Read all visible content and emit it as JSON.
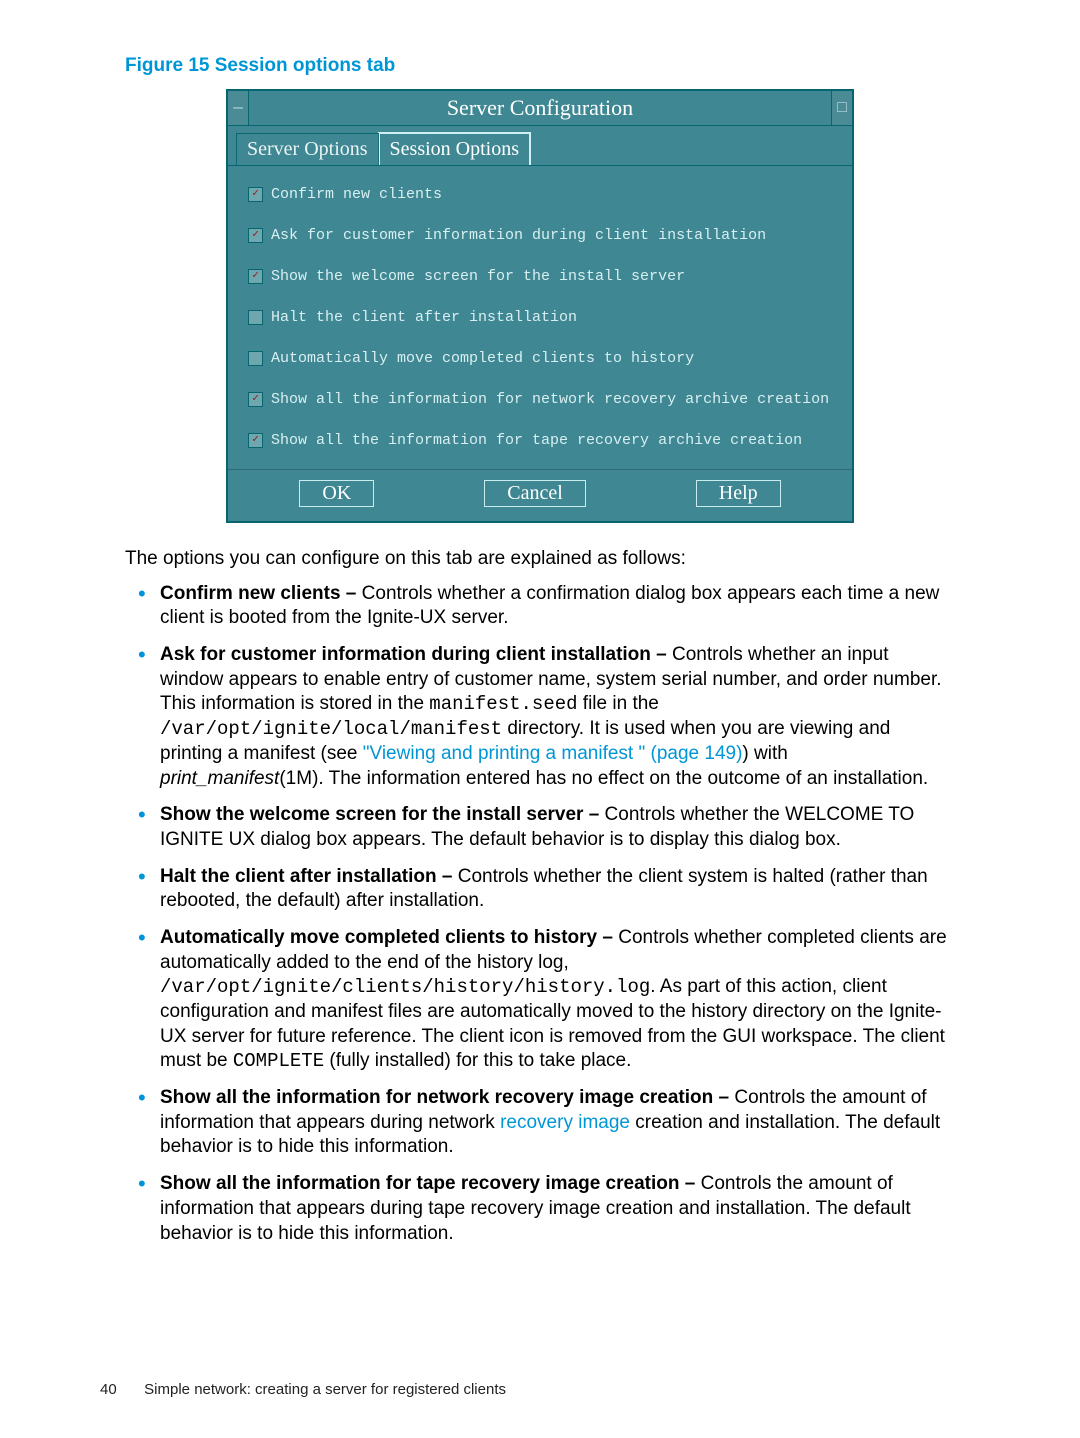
{
  "figure_caption": "Figure 15 Session options tab",
  "dialog": {
    "title": "Server Configuration",
    "sys_menu_glyph": "—",
    "max_glyph": "□",
    "tabs": {
      "server_options": "Server Options",
      "session_options": "Session Options"
    },
    "options": [
      {
        "label": "Confirm new clients",
        "checked": true
      },
      {
        "label": "Ask for customer information during client installation",
        "checked": true
      },
      {
        "label": "Show the welcome screen for the install server",
        "checked": true
      },
      {
        "label": "Halt the client after installation",
        "checked": false
      },
      {
        "label": "Automatically move completed clients to history",
        "checked": false
      },
      {
        "label": "Show all the information for network recovery archive creation",
        "checked": true
      },
      {
        "label": "Show all the information for tape recovery archive creation",
        "checked": true
      }
    ],
    "buttons": {
      "ok": "OK",
      "cancel": "Cancel",
      "help": "Help"
    }
  },
  "intro": "The options you can configure on this tab are explained as follows:",
  "items": {
    "confirm": {
      "title": "Confirm new clients –",
      "rest": " Controls whether a confirmation dialog box appears each time a new client is booted from the Ignite-UX server."
    },
    "ask": {
      "title": "Ask for customer information during client installation –",
      "p1": " Controls whether an input window appears to enable entry of customer name, system serial number, and order number. This information is stored in the ",
      "m1": "manifest.seed",
      "p2": " file in the ",
      "m2": "/var/opt/ignite/local/manifest",
      "p3": " directory. It is used when you are viewing and printing a manifest (see ",
      "link": "\"Viewing and printing a manifest \" (page 149)",
      "p4": ") with ",
      "it": "print_manifest",
      "p5": "(1M). The information entered has no effect on the outcome of an installation."
    },
    "welcome": {
      "title": "Show the welcome screen for the install server –",
      "rest": " Controls whether the WELCOME TO IGNITE UX dialog box appears. The default behavior is to display this dialog box."
    },
    "halt": {
      "title": "Halt the client after installation –",
      "rest": " Controls whether the client system is halted (rather than rebooted, the default) after installation."
    },
    "auto": {
      "title": "Automatically move completed clients to history –",
      "p1": " Controls whether completed clients are automatically added to the end of the history log, ",
      "m1": "/var/opt/ignite/clients/history/history.log",
      "p2": ". As part of this action, client configuration and manifest files are automatically moved to the history directory on the Ignite-UX server for future reference. The client icon is removed from the GUI workspace. The client must be ",
      "m2": "COMPLETE",
      "p3": " (fully installed) for this to take place."
    },
    "net": {
      "title": "Show all the information for network recovery image creation –",
      "p1": " Controls the amount of information that appears during network ",
      "link": "recovery image",
      "p2": " creation and installation. The default behavior is to hide this information."
    },
    "tape": {
      "title": "Show all the information for tape recovery image creation –",
      "rest": " Controls the amount of information that appears during tape recovery image creation and installation. The default behavior is to hide this information."
    }
  },
  "footer": {
    "page": "40",
    "chapter": "Simple network: creating a server for registered clients"
  },
  "check_glyph": "✓"
}
